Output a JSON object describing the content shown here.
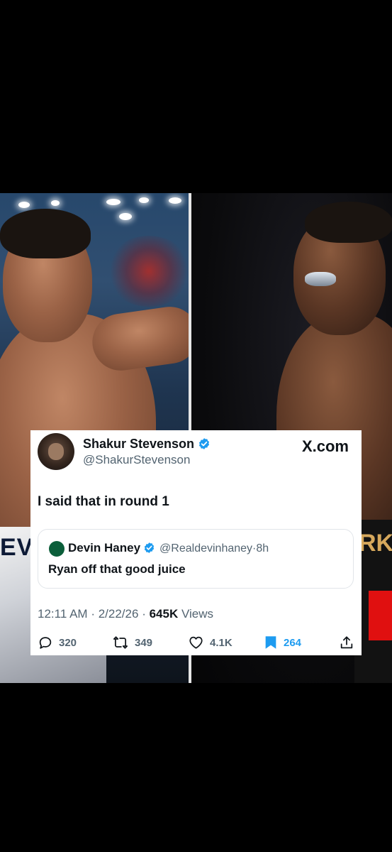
{
  "site_label": "X.com",
  "tweet": {
    "author_name": "Shakur Stevenson",
    "author_handle": "@ShakurStevenson",
    "text": "I said that in round 1",
    "timestamp": "12:11 AM",
    "date": "2/22/26",
    "views_count": "645K",
    "views_label": "Views",
    "separator": "·"
  },
  "quoted_tweet": {
    "author_name": "Devin Haney",
    "author_handle": "@Realdevinhaney",
    "age": "8h",
    "text": "Ryan off that good juice"
  },
  "actions": {
    "replies": "320",
    "reposts": "349",
    "likes": "4.1K",
    "bookmarks": "264"
  },
  "photo": {
    "left_trunks_text": "EV",
    "right_trunks_text": "RK"
  },
  "colors": {
    "verified": "#1d9bf0",
    "bookmark": "#1d9bf0",
    "secondary_text": "#536471",
    "primary_text": "#0f1419"
  }
}
